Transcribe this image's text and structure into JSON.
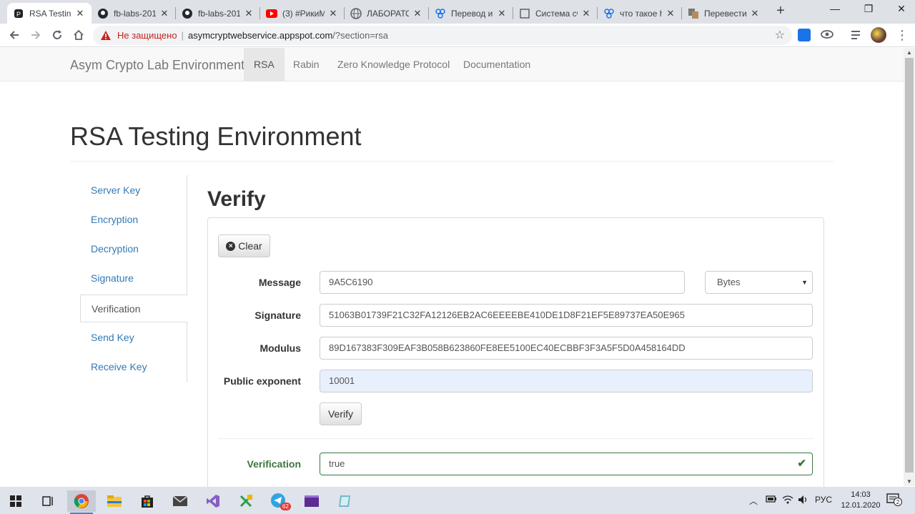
{
  "browser": {
    "tabs": [
      {
        "title": "RSA Testing",
        "icon": "page-icon"
      },
      {
        "title": "fb-labs-201",
        "icon": "github-icon"
      },
      {
        "title": "fb-labs-201",
        "icon": "github-icon"
      },
      {
        "title": "(3) #РикиМ",
        "icon": "youtube-icon"
      },
      {
        "title": "ЛАБОРАТО",
        "icon": "globe-icon"
      },
      {
        "title": "Перевод и",
        "icon": "translate-icon"
      },
      {
        "title": "Система сч",
        "icon": "document-icon"
      },
      {
        "title": "что такое h",
        "icon": "translate-icon"
      },
      {
        "title": "Перевести",
        "icon": "google-translate-icon"
      }
    ],
    "security_label": "Не защищено",
    "url_host": "asymcryptwebservice.appspot.com",
    "url_path": "/?section=rsa"
  },
  "navbar": {
    "brand": "Asym Crypto Lab Environment",
    "links": [
      "RSA",
      "Rabin",
      "Zero Knowledge Protocol",
      "Documentation"
    ]
  },
  "page": {
    "title": "RSA Testing Environment",
    "sidebar": [
      "Server Key",
      "Encryption",
      "Decryption",
      "Signature",
      "Verification",
      "Send Key",
      "Receive Key"
    ],
    "section_title": "Verify",
    "clear_label": "Clear",
    "form": {
      "message_label": "Message",
      "message_value": "9A5C6190",
      "format_value": "Bytes",
      "signature_label": "Signature",
      "signature_value": "51063B01739F21C32FA12126EB2AC6EEEEBE410DE1D8F21EF5E89737EA50E965",
      "modulus_label": "Modulus",
      "modulus_value": "89D167383F309EAF3B058B623860FE8EE5100EC40ECBBF3F3A5F5D0A458164DD",
      "exponent_label": "Public exponent",
      "exponent_value": "10001",
      "verify_label": "Verify",
      "result_label": "Verification",
      "result_value": "true"
    }
  },
  "taskbar": {
    "language": "РУС",
    "time": "14:03",
    "date": "12.01.2020",
    "notifications": "2",
    "telegram_badge": "62"
  }
}
